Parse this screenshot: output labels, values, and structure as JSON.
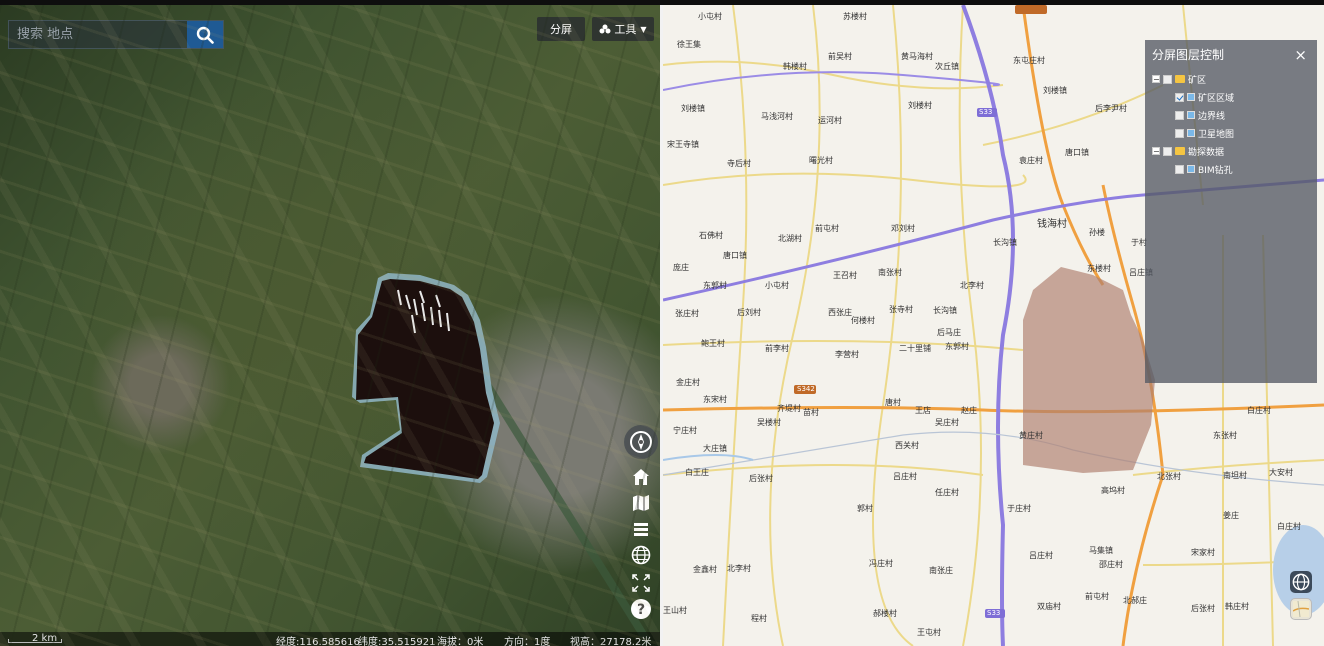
{
  "left_view": {
    "search": {
      "placeholder": "搜索 地点"
    },
    "toolbar": {
      "split_label": "分屏",
      "tools_label": "工具"
    },
    "status": {
      "scale": "2 km",
      "longitude": "经度:116.585616",
      "latitude": "纬度:35.515921",
      "altitude": "海拔：0米",
      "heading": "方向：1度",
      "camera_height": "视高：27178.2米"
    },
    "controls": [
      "compass-icon",
      "home-icon",
      "map-icon",
      "layers-icon",
      "globe-icon",
      "fullscreen-icon",
      "help-icon"
    ]
  },
  "right_view": {
    "layer_panel": {
      "title": "分屏图层控制",
      "close_glyph": "×",
      "tree": [
        {
          "label": "矿区",
          "checked": false
        },
        {
          "label": "矿区区域",
          "checked": true
        },
        {
          "label": "边界线",
          "checked": false
        },
        {
          "label": "卫星地图",
          "checked": false
        },
        {
          "label": "勘探数据",
          "checked": false
        },
        {
          "label": "BIM钻孔",
          "checked": false
        }
      ]
    },
    "map_labels": {
      "l1": "小屯村",
      "l2": "徐王集",
      "l3": "韩楼村",
      "l4": "前吴村",
      "l5": "黄马海村",
      "l6": "次丘镇",
      "l7": "苏楼村",
      "l8": "东屯庄村",
      "l9": "刘楼村",
      "l10": "刘楼镇",
      "l11": "运河村",
      "l12": "后李尹村",
      "l13": "马浅河村",
      "l14": "刘楼镇",
      "l15": "宋王寺镇",
      "l16": "寺后村",
      "l17": "曙光村",
      "l18": "袁庄村",
      "l19": "唐口镇",
      "l20": "钱海村",
      "l21": "前屯村",
      "l22": "邓刘村",
      "l23": "石佛村",
      "l24": "唐口镇",
      "l25": "北湖村",
      "l26": "东郭村",
      "l27": "小屯村",
      "l28": "王召村",
      "l29": "南张村",
      "l30": "北李村",
      "l31": "张庄村",
      "l32": "后刘村",
      "l33": "西张庄",
      "l34": "张寺村",
      "l35": "长沟镇",
      "l36": "鲍王村",
      "l37": "前李村",
      "l38": "李营村",
      "l39": "二十里铺",
      "l40": "东郭村",
      "l41": "金庄村",
      "l42": "东宋村",
      "l43": "齐堤村",
      "l44": "苗村",
      "l45": "唐村",
      "l46": "王店",
      "l47": "赵庄",
      "l48": "吴庄村",
      "l49": "宁庄村",
      "l50": "吴楼村",
      "l51": "大庄镇",
      "l52": "西关村",
      "l53": "黄庄村",
      "l54": "后张村",
      "l55": "吕庄村",
      "l56": "任庄村",
      "l57": "于庄村",
      "l58": "高坞村",
      "l59": "北张村",
      "l60": "郭村",
      "l61": "吕庄村",
      "l62": "马集镇",
      "l63": "邵庄村",
      "l64": "冯庄村",
      "l65": "南张庄",
      "l66": "金鑫村",
      "l67": "北李村",
      "l68": "宋家村",
      "l69": "白庄村",
      "l70": "程村",
      "l71": "郝楼村",
      "l72": "王屯村",
      "l73": "王山村",
      "l74": "双庙村",
      "l75": "前屯村",
      "l76": "北郝庄",
      "l77": "后张村",
      "l78": "韩庄村",
      "l79": "东张村",
      "l80": "南坦村",
      "l81": "姜庄",
      "l82": "大安村",
      "l83": "白庄村",
      "l84": "吕庄镇",
      "l85": "东楼村",
      "l86": "孙楼",
      "l87": "于村",
      "l88": "长沟镇",
      "l89": "后马庄",
      "l90": "何楼村",
      "l91": "庞庄",
      "l92": "白王庄"
    },
    "road_shields": [
      "S33",
      "S33",
      "S33",
      "S342"
    ]
  }
}
